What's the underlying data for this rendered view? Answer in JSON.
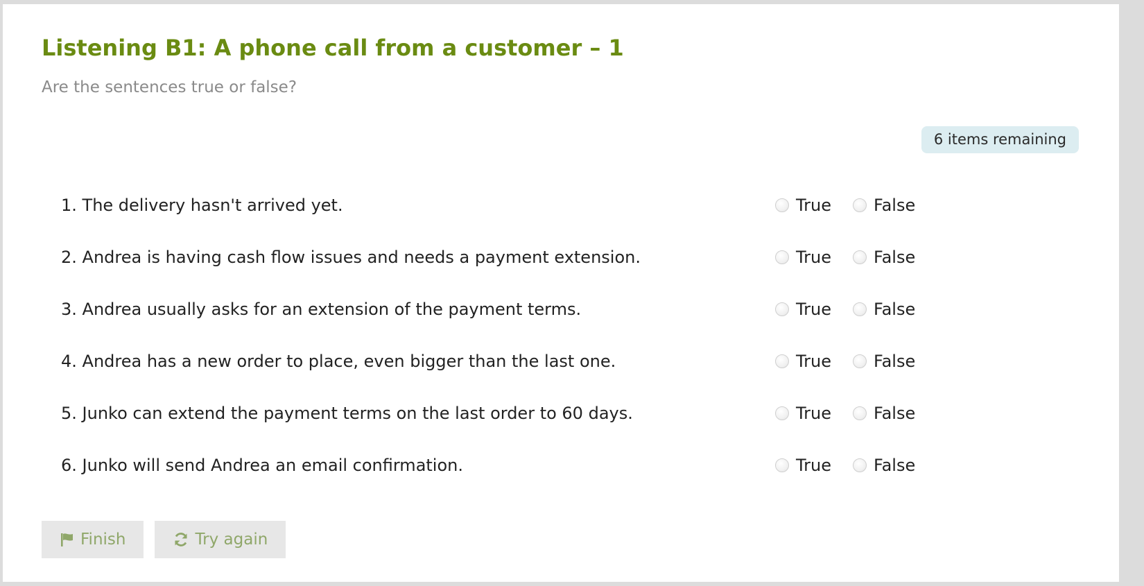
{
  "header": {
    "title": "Listening B1: A phone call from a customer – 1",
    "instruction": "Are the sentences true or false?"
  },
  "status": {
    "remaining": "6 items remaining"
  },
  "options": {
    "true_label": "True",
    "false_label": "False"
  },
  "questions": [
    "1. The delivery hasn't arrived yet.",
    "2. Andrea is having cash flow issues and needs a payment extension.",
    "3. Andrea usually asks for an extension of the payment terms.",
    "4. Andrea has a new order to place, even bigger than the last one.",
    "5. Junko can extend the payment terms on the last order to 60 days.",
    "6. Junko will send Andrea an email confirmation."
  ],
  "buttons": {
    "finish_label": "Finish",
    "finish_icon": "flag-icon",
    "retry_label": "Try again",
    "retry_icon": "refresh-icon"
  },
  "colors": {
    "title": "#6a8b12",
    "badge_bg": "#dcedf1",
    "button_text": "#8fa769",
    "button_bg": "#e7e7e7"
  }
}
